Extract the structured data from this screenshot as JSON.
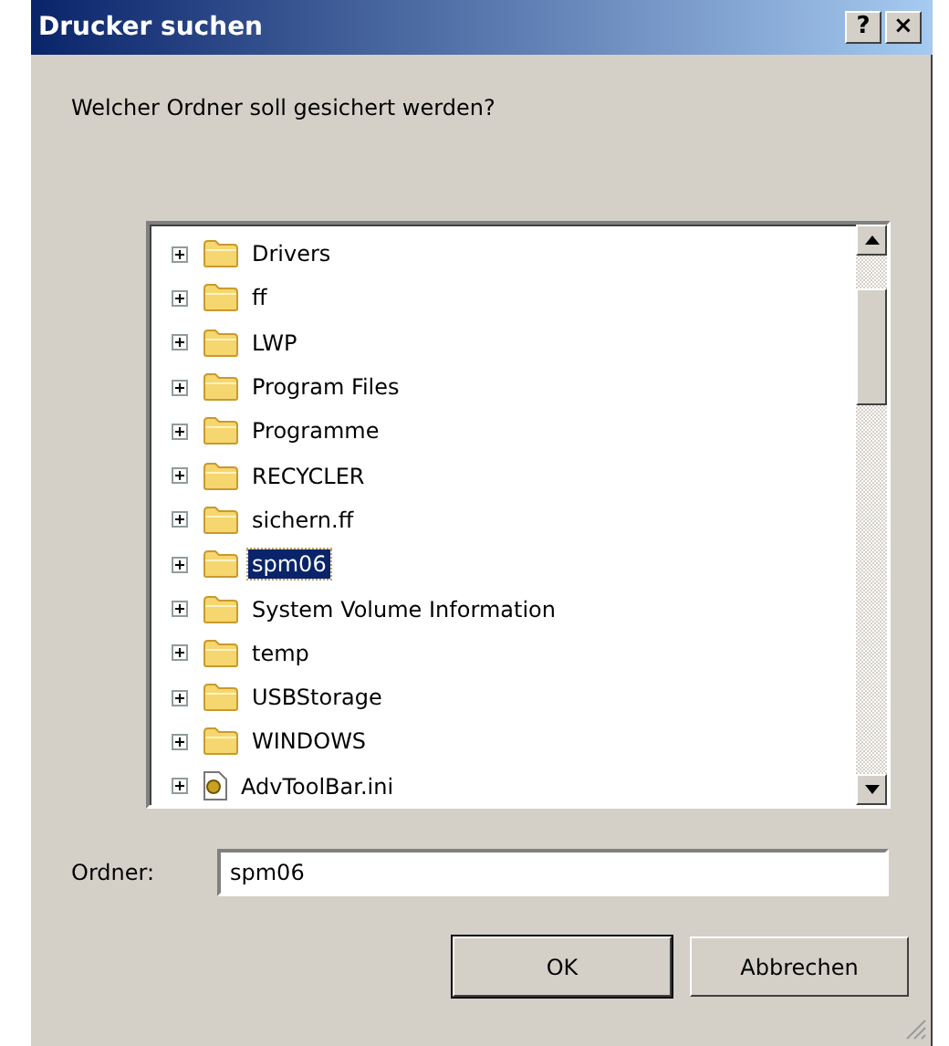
{
  "window": {
    "title": "Drucker suchen",
    "help_button": "?",
    "close_button": "×"
  },
  "prompt": "Welcher Ordner soll gesichert werden?",
  "tree": {
    "items": [
      {
        "kind": "folder",
        "label": "Drivers",
        "expanded": false,
        "selected": false
      },
      {
        "kind": "folder",
        "label": "ff",
        "expanded": false,
        "selected": false
      },
      {
        "kind": "folder",
        "label": "LWP",
        "expanded": false,
        "selected": false
      },
      {
        "kind": "folder",
        "label": "Program Files",
        "expanded": false,
        "selected": false
      },
      {
        "kind": "folder",
        "label": "Programme",
        "expanded": false,
        "selected": false
      },
      {
        "kind": "folder",
        "label": "RECYCLER",
        "expanded": false,
        "selected": false
      },
      {
        "kind": "folder",
        "label": "sichern.ff",
        "expanded": false,
        "selected": false
      },
      {
        "kind": "folder",
        "label": "spm06",
        "expanded": false,
        "selected": true
      },
      {
        "kind": "folder",
        "label": "System Volume Information",
        "expanded": false,
        "selected": false
      },
      {
        "kind": "folder",
        "label": "temp",
        "expanded": false,
        "selected": false
      },
      {
        "kind": "folder",
        "label": "USBStorage",
        "expanded": false,
        "selected": false
      },
      {
        "kind": "folder",
        "label": "WINDOWS",
        "expanded": false,
        "selected": false
      },
      {
        "kind": "file",
        "label": "AdvToolBar.ini",
        "expanded": false,
        "selected": false
      }
    ]
  },
  "folder_field": {
    "label": "Ordner:",
    "value": "spm06"
  },
  "buttons": [
    {
      "label": "OK",
      "default": true
    },
    {
      "label": "Abbrechen",
      "default": false
    }
  ]
}
